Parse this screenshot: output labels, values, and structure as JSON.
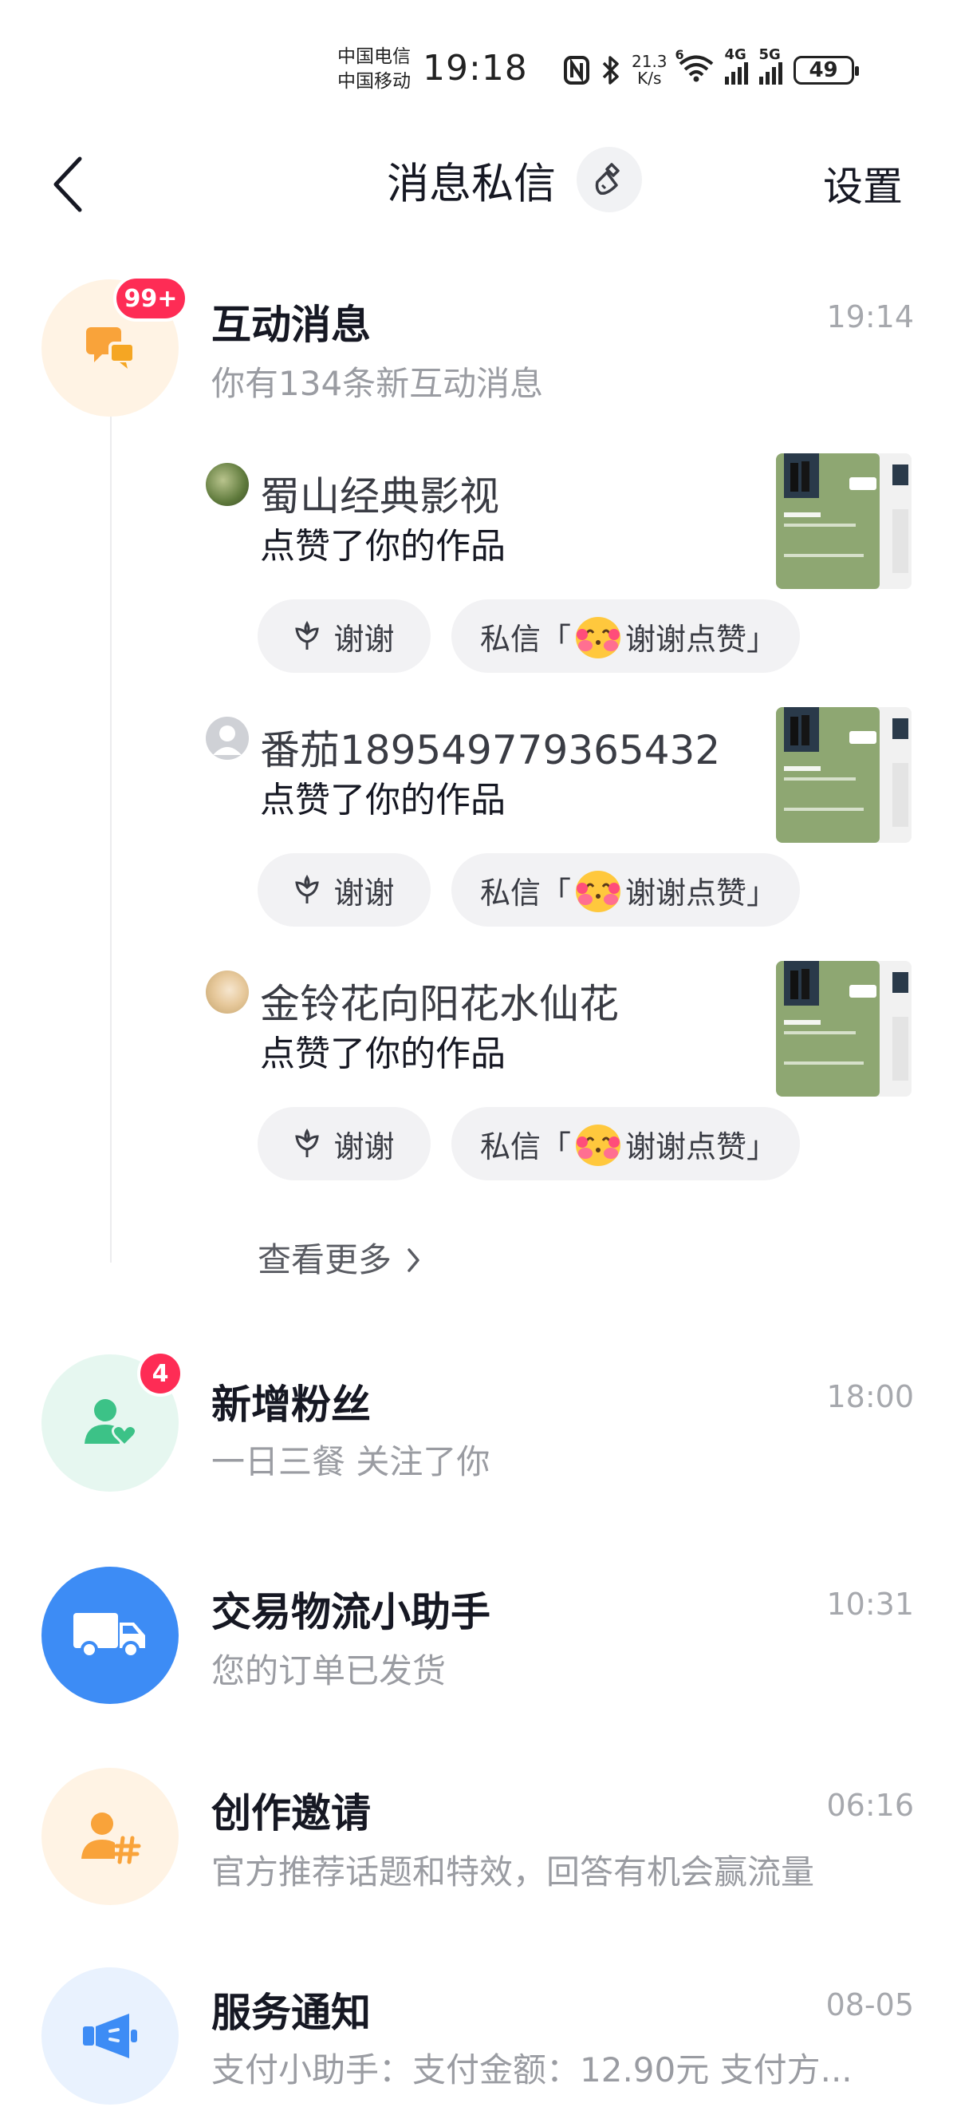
{
  "status_bar": {
    "carrier_1": "中国电信",
    "carrier_2": "中国移动",
    "time": "19:18",
    "speed_value": "21.3",
    "speed_unit": "K/s",
    "network_1": "4G",
    "network_2": "5G",
    "wifi_level": "6",
    "battery": "49"
  },
  "header": {
    "title": "消息私信",
    "settings": "设置"
  },
  "interaction": {
    "title": "互动消息",
    "subtitle": "你有134条新互动消息",
    "time": "19:14",
    "badge": "99+",
    "items": [
      {
        "name": "蜀山经典影视",
        "action": "点赞了你的作品",
        "thanks": "谢谢",
        "dm_prefix": "私信「",
        "dm_suffix": "谢谢点赞」"
      },
      {
        "name": "番茄189549779365432",
        "action": "点赞了你的作品",
        "thanks": "谢谢",
        "dm_prefix": "私信「",
        "dm_suffix": "谢谢点赞」"
      },
      {
        "name": "金铃花向阳花水仙花",
        "action": "点赞了你的作品",
        "thanks": "谢谢",
        "dm_prefix": "私信「",
        "dm_suffix": "谢谢点赞」"
      }
    ],
    "see_more": "查看更多"
  },
  "conversations": [
    {
      "title": "新增粉丝",
      "subtitle": "一日三餐 关注了你",
      "time": "18:00",
      "badge": "4"
    },
    {
      "title": "交易物流小助手",
      "subtitle": "您的订单已发货",
      "time": "10:31"
    },
    {
      "title": "创作邀请",
      "subtitle": "官方推荐话题和特效，回答有机会赢流量",
      "time": "06:16"
    },
    {
      "title": "服务通知",
      "subtitle": "支付小助手：支付金额：12.90元 支付方...",
      "time": "08-05"
    }
  ],
  "colors": {
    "accent_red": "#fe2c55",
    "orange": "#f9a33a",
    "green": "#3cc287",
    "blue": "#3d8cf5"
  }
}
